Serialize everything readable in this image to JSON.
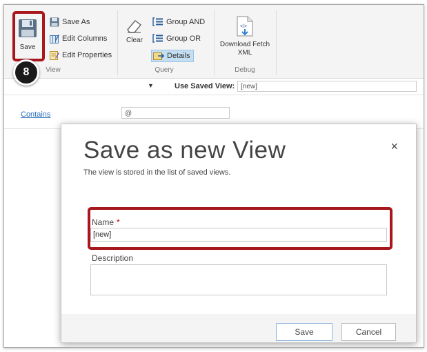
{
  "ribbon": {
    "view_group": {
      "save_label": "Save",
      "save_as_label": "Save As",
      "edit_columns_label": "Edit Columns",
      "edit_properties_label": "Edit Properties",
      "group_label": "View"
    },
    "query_group": {
      "clear_label": "Clear",
      "group_and_label": "Group AND",
      "group_or_label": "Group OR",
      "details_label": "Details",
      "group_label": "Query"
    },
    "debug_group": {
      "download_label_line1": "Download Fetch",
      "download_label_line2": "XML",
      "group_label": "Debug"
    }
  },
  "viewbar": {
    "caret": "▼",
    "use_saved_view_label": "Use Saved View:",
    "saved_view_value": "[new]"
  },
  "criteria": {
    "operator_link": "Contains",
    "value": "@"
  },
  "annotation": {
    "step_number": "8"
  },
  "dialog": {
    "title": "Save as new View",
    "subtitle": "The view is stored in the list of saved views.",
    "close_glyph": "×",
    "name_label": "Name",
    "required_marker": "*",
    "name_value": "[new]",
    "description_label": "Description",
    "description_value": "",
    "save_button": "Save",
    "cancel_button": "Cancel"
  },
  "colors": {
    "highlight_red": "#a8171d",
    "link_blue": "#2a6ebb",
    "details_highlight": "#c4dff2",
    "ribbon_bg": "#f4f4f4"
  }
}
